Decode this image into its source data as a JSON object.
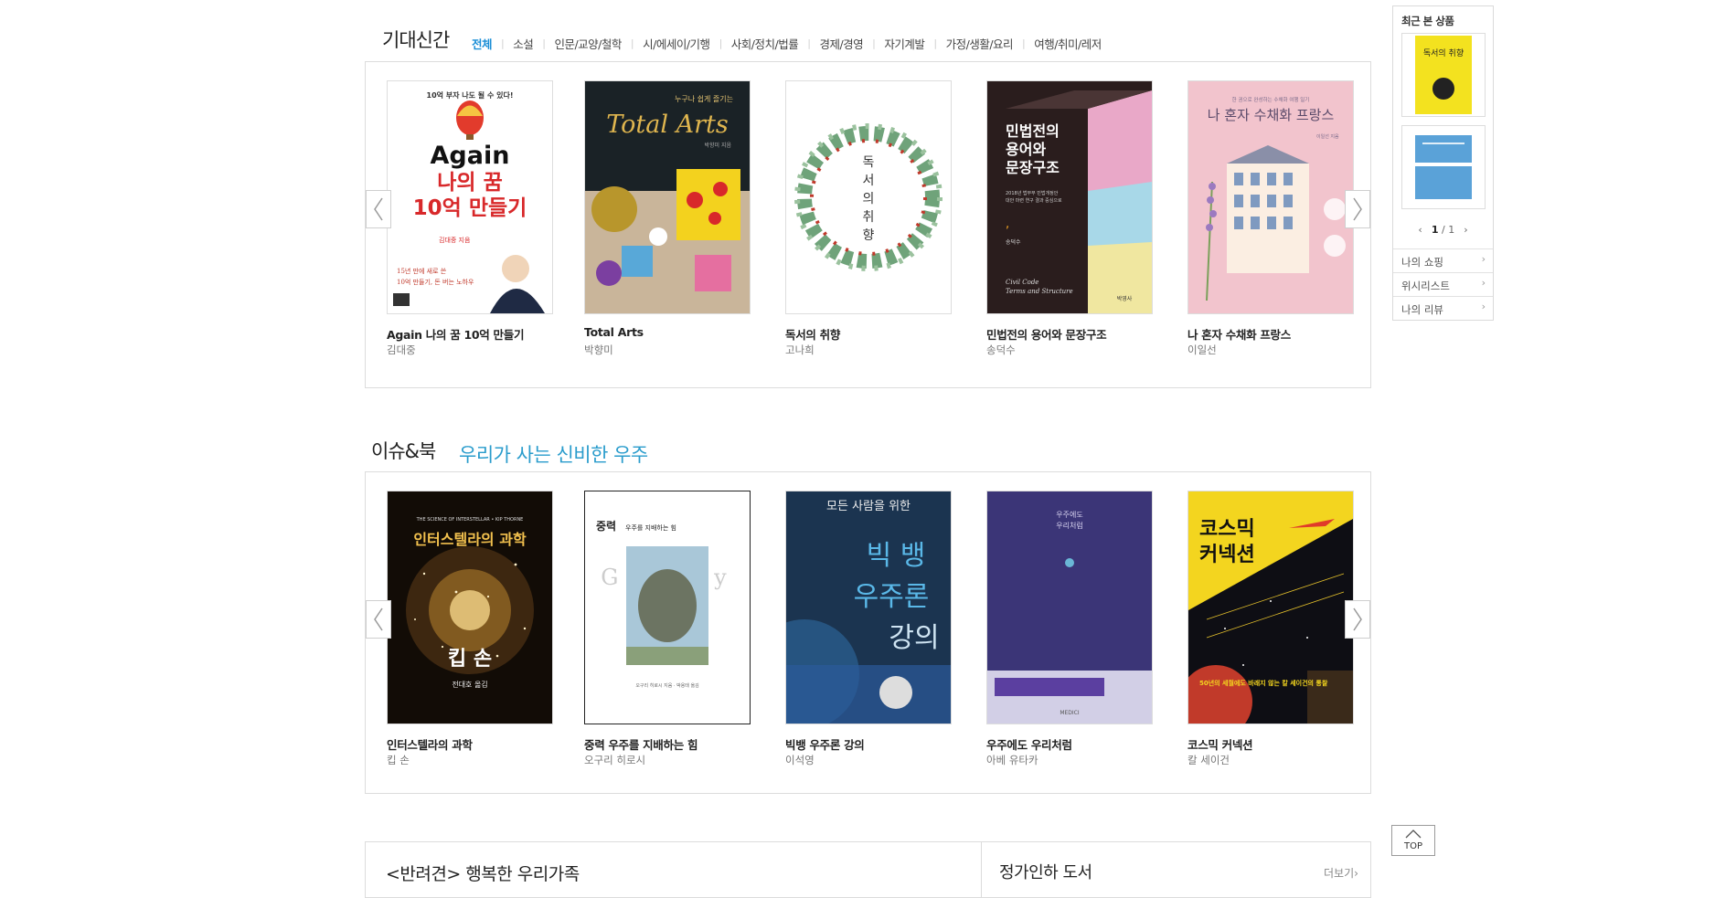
{
  "new_books": {
    "title": "기대신간",
    "tabs": [
      "전체",
      "소설",
      "인문/교양/철학",
      "시/에세이/기행",
      "사회/정치/법률",
      "경제/경영",
      "자기계발",
      "가정/생활/요리",
      "여행/취미/레저"
    ],
    "books": [
      {
        "title": "Again 나의 꿈 10억 만들기",
        "author": "김대중",
        "cover": {
          "top": "10억 부자 나도 될 수 있다!",
          "line1": "Again",
          "line2": "나의 꿈",
          "line3": "10억 만들기",
          "tag1": "15년 만에 새로 쓴",
          "tag2": "10억 만들기, 돈 버는 노하우",
          "author": "김대중 지음"
        }
      },
      {
        "title": "Total Arts",
        "author": "박향미",
        "cover": {
          "small": "누구나 쉽게 즐기는",
          "main": "Total Arts",
          "author": "박향미 지음"
        }
      },
      {
        "title": "독서의 취향",
        "author": "고나희",
        "cover": {
          "c1": "독",
          "c2": "서",
          "c3": "의",
          "c4": "취",
          "c5": "향"
        }
      },
      {
        "title": "민법전의 용어와 문장구조",
        "author": "송덕수",
        "cover": {
          "l1": "민법전의",
          "l2": "용어와",
          "l3": "문장구조",
          "desc1": "2018년 법무부 민법개정안",
          "desc2": "대안 마련 연구 결과 중심으로",
          "name": "송덕수",
          "en1": "Civil Code",
          "en2": "Terms and Structure",
          "pub": "박영사"
        }
      },
      {
        "title": "나 혼자 수채화 프랑스",
        "author": "이일선",
        "cover": {
          "small": "한 권으로 완성하는 수채화 여행 일기",
          "main": "나 혼자 수채화 프랑스",
          "author": "이일선 지음"
        }
      }
    ]
  },
  "issue_books": {
    "title": "이슈&북",
    "subtitle": "우리가 사는 신비한 우주",
    "books": [
      {
        "title": "인터스텔라의 과학",
        "author": "킵 손",
        "cover": {
          "en": "THE SCIENCE OF INTERSTELLAR • KIP THORNE",
          "main": "인터스텔라의 과학",
          "name": "킵 손",
          "sub": "전대호 옮김"
        }
      },
      {
        "title": "중력 우주를 지배하는 힘",
        "author": "오구리 히로시",
        "cover": {
          "main": "중력",
          "sub": "우주를 지배하는 힘",
          "en": "Gravity",
          "author": "오구리 히로시 지음 · 박용태 옮김"
        }
      },
      {
        "title": "빅뱅 우주론 강의",
        "author": "이석영",
        "cover": {
          "top": "모든 사람을 위한",
          "l1": "빅 뱅",
          "l2": "우주론",
          "l3": "강의"
        }
      },
      {
        "title": "우주에도 우리처럼",
        "author": "아베 유타카",
        "cover": {
          "l1": "우주에도",
          "l2": "우리처럼",
          "pub": "MEDICI"
        }
      },
      {
        "title": "코스믹 커넥션",
        "author": "칼 세이건",
        "cover": {
          "l1": "코스믹",
          "l2": "커넥션",
          "tag": "50년의 세월에도 바래지 않는 칼 세이건의 통찰"
        }
      }
    ]
  },
  "sidebar": {
    "heading": "최근 본 상품",
    "thumb1_text": "독서의 취향",
    "page_current": "1",
    "page_sep": "/",
    "page_total": "1",
    "links": [
      "나의 쇼핑",
      "위시리스트",
      "나의 리뷰"
    ]
  },
  "top_button": "TOP",
  "bottom": {
    "left_title": "<반려견> 행복한 우리가족",
    "right_title": "정가인하 도서",
    "more": "더보기"
  },
  "colors": {
    "accent": "#1a8ed6",
    "subtitle": "#2a9ccc",
    "border": "#dcdcdc"
  }
}
